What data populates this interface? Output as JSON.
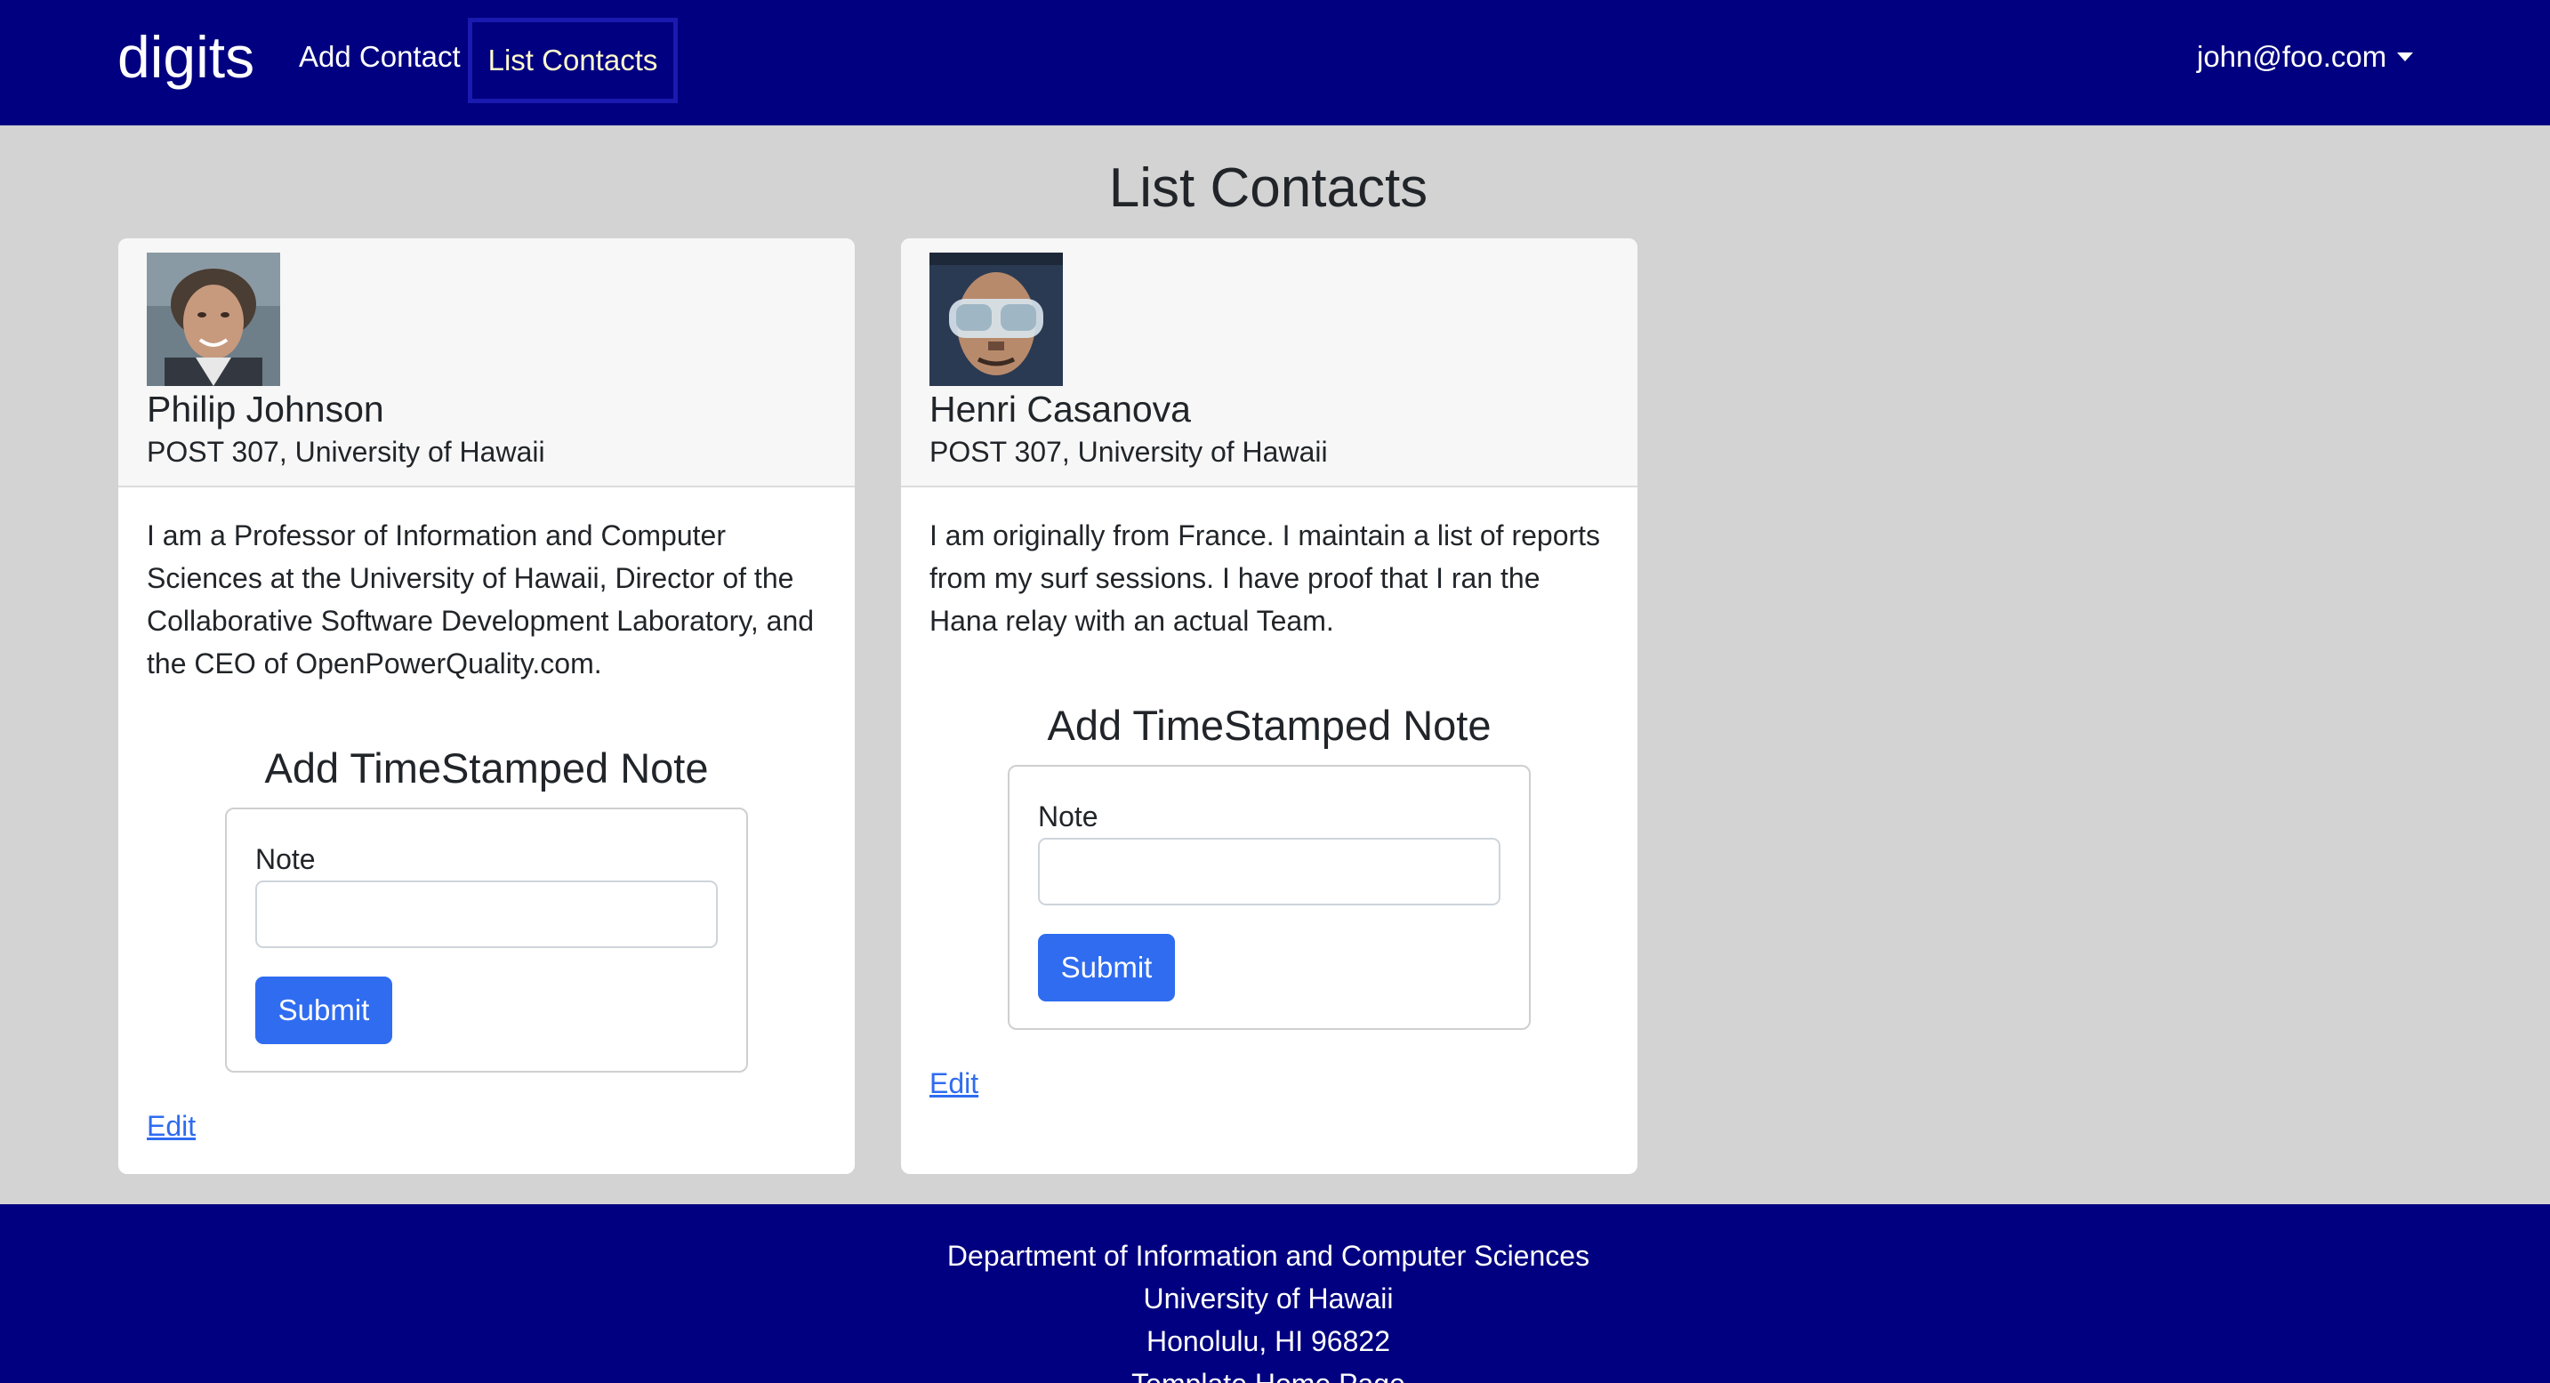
{
  "navbar": {
    "brand": "digits",
    "links": [
      {
        "label": "Add Contact"
      },
      {
        "label": "List Contacts"
      }
    ],
    "user_email": "john@foo.com",
    "bg_color": "#000080"
  },
  "page": {
    "title": "List Contacts",
    "bg_color": "#d3d3d3"
  },
  "contacts": [
    {
      "name": "Philip Johnson",
      "address": "POST 307, University of Hawaii",
      "description": "I am a Professor of Information and Computer Sciences at the University of Hawaii, Director of the Collaborative Software Development Laboratory, and the CEO of OpenPowerQuality.com.",
      "note_form": {
        "title": "Add TimeStamped Note",
        "label": "Note",
        "value": "",
        "submit_label": "Submit"
      },
      "edit_label": "Edit"
    },
    {
      "name": "Henri Casanova",
      "address": "POST 307, University of Hawaii",
      "description": "I am originally from France. I maintain a list of reports from my surf sessions. I have proof that I ran the Hana relay with an actual Team.",
      "note_form": {
        "title": "Add TimeStamped Note",
        "label": "Note",
        "value": "",
        "submit_label": "Submit"
      },
      "edit_label": "Edit"
    }
  ],
  "footer": {
    "lines": [
      "Department of Information and Computer Sciences",
      "University of Hawaii",
      "Honolulu, HI 96822",
      "Template Home Page"
    ]
  },
  "colors": {
    "accent": "#2f6cf0",
    "active_nav_text": "#fffacd"
  }
}
